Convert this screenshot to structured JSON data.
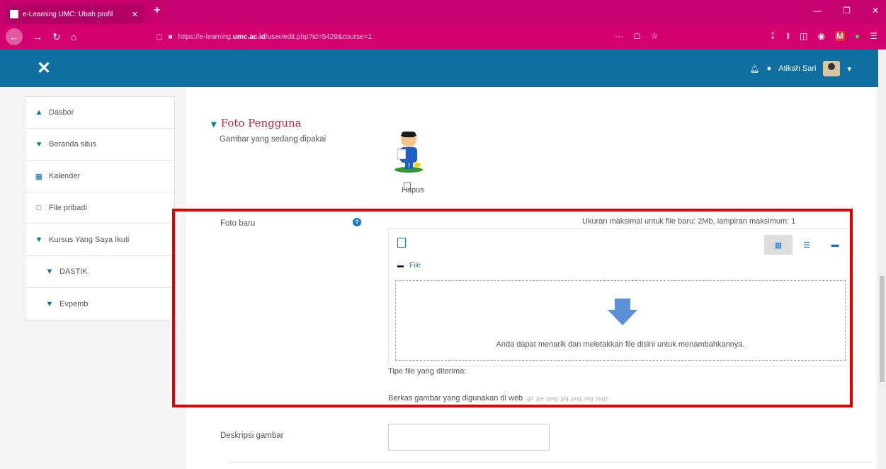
{
  "browser": {
    "tab_title": "e-Learning UMC: Ubah profil",
    "tab_close": "✕",
    "new_tab": "+",
    "url_prefix": "https://e-learning.",
    "url_domain": "umc.ac.id",
    "url_rest": "/user/edit.php?id=5429&course=1",
    "url_actions": [
      "···",
      "☖",
      "☆"
    ],
    "window_buttons": [
      "—",
      "❐",
      "✕"
    ]
  },
  "navbar": {
    "close_label": "✕",
    "user_name": "Atikah Sari",
    "dropdown_caret": "▾"
  },
  "sidebar": {
    "items": [
      {
        "label": "Dasbor",
        "icon": "dashboard-icon"
      },
      {
        "label": "Beranda situs",
        "icon": "home-icon"
      },
      {
        "label": "Kalender",
        "icon": "calendar-icon"
      },
      {
        "label": "File pribadi",
        "icon": "file-icon"
      },
      {
        "label": "Kursus Yang Saya Ikuti",
        "icon": "graduation-cap-icon"
      },
      {
        "label": "DASTIK",
        "icon": "graduation-cap-icon"
      },
      {
        "label": "Evpemb",
        "icon": "graduation-cap-icon"
      }
    ]
  },
  "main": {
    "section_title": "Foto Pengguna",
    "current_image_label": "Gambar yang sedang dipakai",
    "delete_label": "Hapus",
    "new_photo_label": "Foto baru",
    "max_size_text": "Ukuran maksimal untuk file baru: 2Mb, lampiran maksimum: 1",
    "filepicker": {
      "path_label": "File",
      "drop_text": "Anda dapat menarik dan meletakkan file disini untuk menambahkannya."
    },
    "accepted_types_label": "Tipe file yang diterima:",
    "web_images_label": "Berkas gambar yang digunakan di web",
    "web_images_exts": ".gif .jpe .jpeg .jpg .png .svg .svgz",
    "description_label": "Deskripsi gambar"
  }
}
